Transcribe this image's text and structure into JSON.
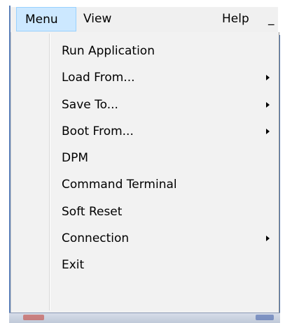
{
  "menubar": {
    "items": [
      {
        "label": "Menu",
        "active": true
      },
      {
        "label": "View",
        "active": false
      },
      {
        "label": "Help",
        "active": false
      }
    ],
    "minimize_glyph": "_"
  },
  "dropdown": {
    "items": [
      {
        "label": "Run Application",
        "has_submenu": false
      },
      {
        "label": "Load From...",
        "has_submenu": true
      },
      {
        "label": "Save To...",
        "has_submenu": true
      },
      {
        "label": "Boot From...",
        "has_submenu": true
      },
      {
        "label": "DPM",
        "has_submenu": false
      },
      {
        "label": "Command Terminal",
        "has_submenu": false
      },
      {
        "label": "Soft Reset",
        "has_submenu": false
      },
      {
        "label": "Connection",
        "has_submenu": true
      },
      {
        "label": "Exit",
        "has_submenu": false
      }
    ]
  },
  "colors": {
    "menubar_background": "#f0f0f0",
    "active_highlight": "#cce8ff",
    "active_border": "#99d1ff",
    "dropdown_background": "#f2f2f2",
    "window_frame": "#5a7fb8"
  }
}
